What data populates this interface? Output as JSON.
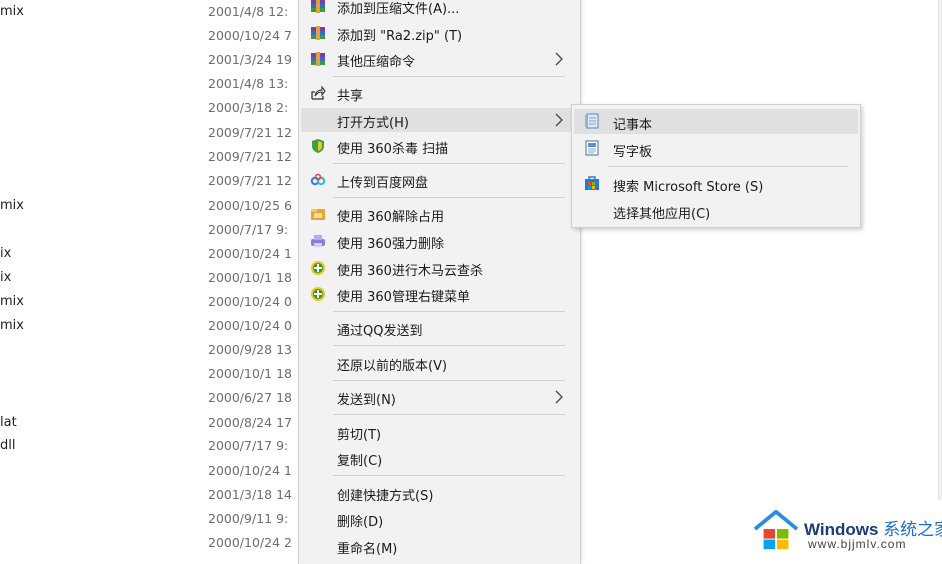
{
  "explorer": {
    "file_names": [
      {
        "text": "mix",
        "row": 0
      },
      {
        "text": "mix",
        "row": 8
      },
      {
        "text": "ix",
        "row": 10
      },
      {
        "text": "ix",
        "row": 11
      },
      {
        "text": "mix",
        "row": 12
      },
      {
        "text": "mix",
        "row": 13
      },
      {
        "text": "lat",
        "row": 17
      },
      {
        "text": "dll",
        "row": 18
      }
    ],
    "dates": [
      "2001/4/8 12:",
      "2000/10/24 7",
      "2001/3/24 19",
      "2001/4/8 13:",
      "2000/3/18 2:",
      "2009/7/21 12",
      "2009/7/21 12",
      "2009/7/21 12",
      "2000/10/25 6",
      "2000/7/17 9:",
      "2000/10/24 1",
      "2000/10/1 18",
      "2000/10/24 0",
      "2000/10/24 0",
      "2000/9/28 13",
      "2000/10/1 18",
      "2000/6/27 18",
      "2000/8/24 17",
      "2000/7/17 9:",
      "2000/10/24 1",
      "2001/3/18 14",
      "2000/9/11 9:",
      "2000/10/24 2"
    ]
  },
  "context_menu": {
    "items": [
      {
        "label": "添加到压缩文件(A)...",
        "icon": "winrar-archive-icon"
      },
      {
        "label": "添加到 \"Ra2.zip\" (T)",
        "icon": "winrar-archive-icon"
      },
      {
        "label": "其他压缩命令",
        "icon": "winrar-archive-icon",
        "submenu": true
      },
      {
        "label": "共享",
        "icon": "share-icon"
      },
      {
        "label": "打开方式(H)",
        "icon": "",
        "submenu": true,
        "highlighted": true
      },
      {
        "label": "使用 360杀毒 扫描",
        "icon": "360-shield-icon"
      },
      {
        "label": "上传到百度网盘",
        "icon": "baidu-netdisk-icon"
      },
      {
        "label": "使用 360解除占用",
        "icon": "360-unlock-icon"
      },
      {
        "label": "使用 360强力删除",
        "icon": "360-force-delete-icon"
      },
      {
        "label": "使用 360进行木马云查杀",
        "icon": "360-trojan-scan-icon"
      },
      {
        "label": "使用 360管理右键菜单",
        "icon": "360-menu-manage-icon"
      },
      {
        "label": "通过QQ发送到",
        "icon": ""
      },
      {
        "label": "还原以前的版本(V)",
        "icon": ""
      },
      {
        "label": "发送到(N)",
        "icon": "",
        "submenu": true
      },
      {
        "label": "剪切(T)",
        "icon": ""
      },
      {
        "label": "复制(C)",
        "icon": ""
      },
      {
        "label": "创建快捷方式(S)",
        "icon": ""
      },
      {
        "label": "删除(D)",
        "icon": ""
      },
      {
        "label": "重命名(M)",
        "icon": ""
      }
    ]
  },
  "open_with_submenu": {
    "items": [
      {
        "label": "记事本",
        "icon": "notepad-icon",
        "highlighted": true
      },
      {
        "label": "写字板",
        "icon": "wordpad-icon"
      },
      {
        "label": "搜索 Microsoft Store (S)",
        "icon": "microsoft-store-icon"
      },
      {
        "label": "选择其他应用(C)",
        "icon": ""
      }
    ]
  },
  "watermark": {
    "brand": "Windows",
    "brand_cn": "系统之家",
    "url": "www.bjjmlv.com"
  },
  "colors": {
    "menu_bg": "#f2f2f2",
    "highlight": "#e0e0e0",
    "separator": "#d0d0d0",
    "date_text": "#6d6d6d"
  }
}
